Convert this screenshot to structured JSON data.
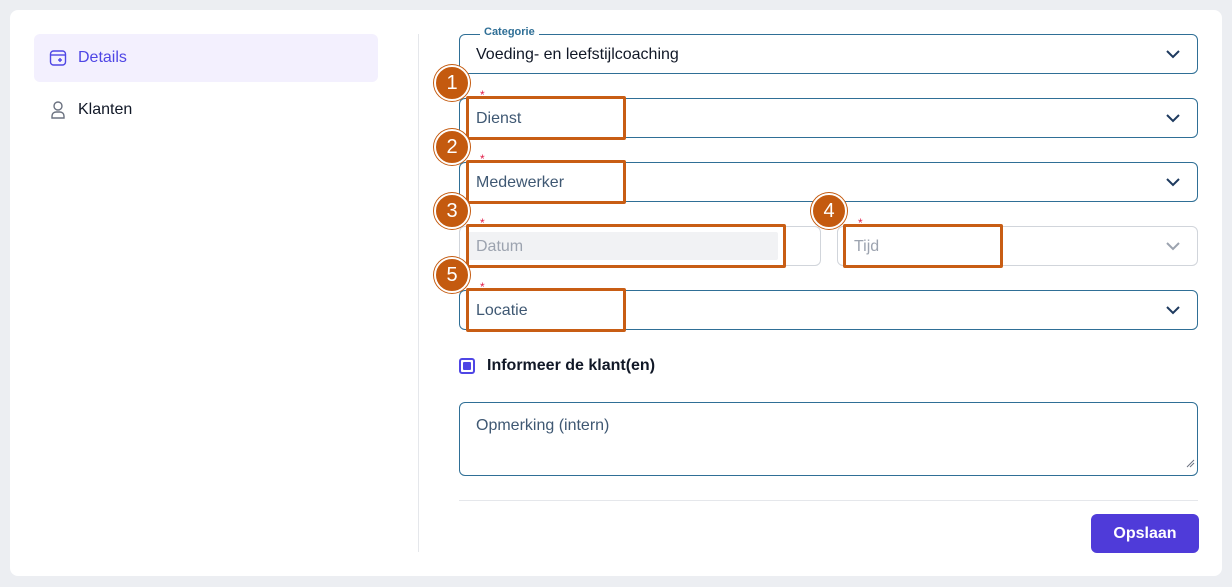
{
  "sidebar": {
    "items": [
      {
        "label": "Details",
        "icon": "calendar-plus-icon",
        "active": true
      },
      {
        "label": "Klanten",
        "icon": "user-icon",
        "active": false
      }
    ]
  },
  "form": {
    "categorie": {
      "legend": "Categorie",
      "value": "Voeding- en leefstijlcoaching"
    },
    "dienst": {
      "placeholder": "Dienst",
      "required": "*"
    },
    "medewerker": {
      "placeholder": "Medewerker",
      "required": "*"
    },
    "datum": {
      "placeholder": "Datum",
      "required": "*"
    },
    "tijd": {
      "placeholder": "Tijd",
      "required": "*"
    },
    "locatie": {
      "placeholder": "Locatie",
      "required": "*"
    },
    "informeer": {
      "label": "Informeer de klant(en)",
      "checked": true
    },
    "opmerking": {
      "placeholder": "Opmerking (intern)"
    },
    "save_label": "Opslaan"
  },
  "annotations": [
    "1",
    "2",
    "3",
    "4",
    "5"
  ],
  "colors": {
    "accent": "#4f3bd9",
    "field_border": "#2f6f96",
    "highlight": "#c85d14",
    "required": "#e11d48"
  }
}
